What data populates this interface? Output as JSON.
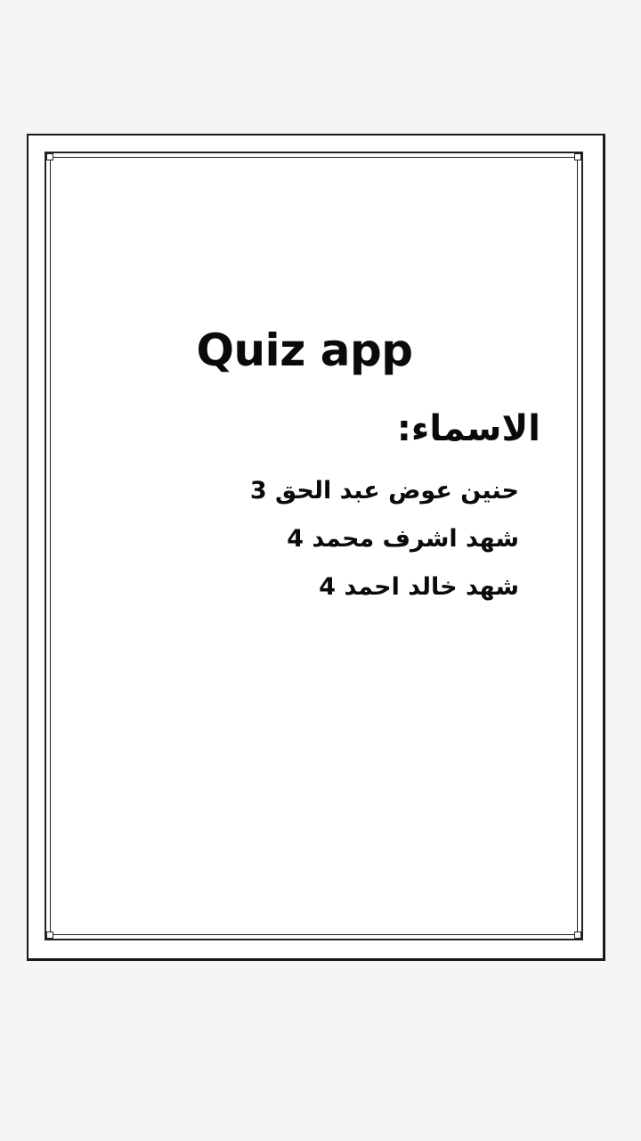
{
  "document": {
    "title": "Quiz app",
    "names_heading": "الاسماء:",
    "names": [
      "حنين عوض عبد الحق 3",
      "شهد اشرف محمد 4",
      "شهد خالد احمد 4"
    ]
  }
}
